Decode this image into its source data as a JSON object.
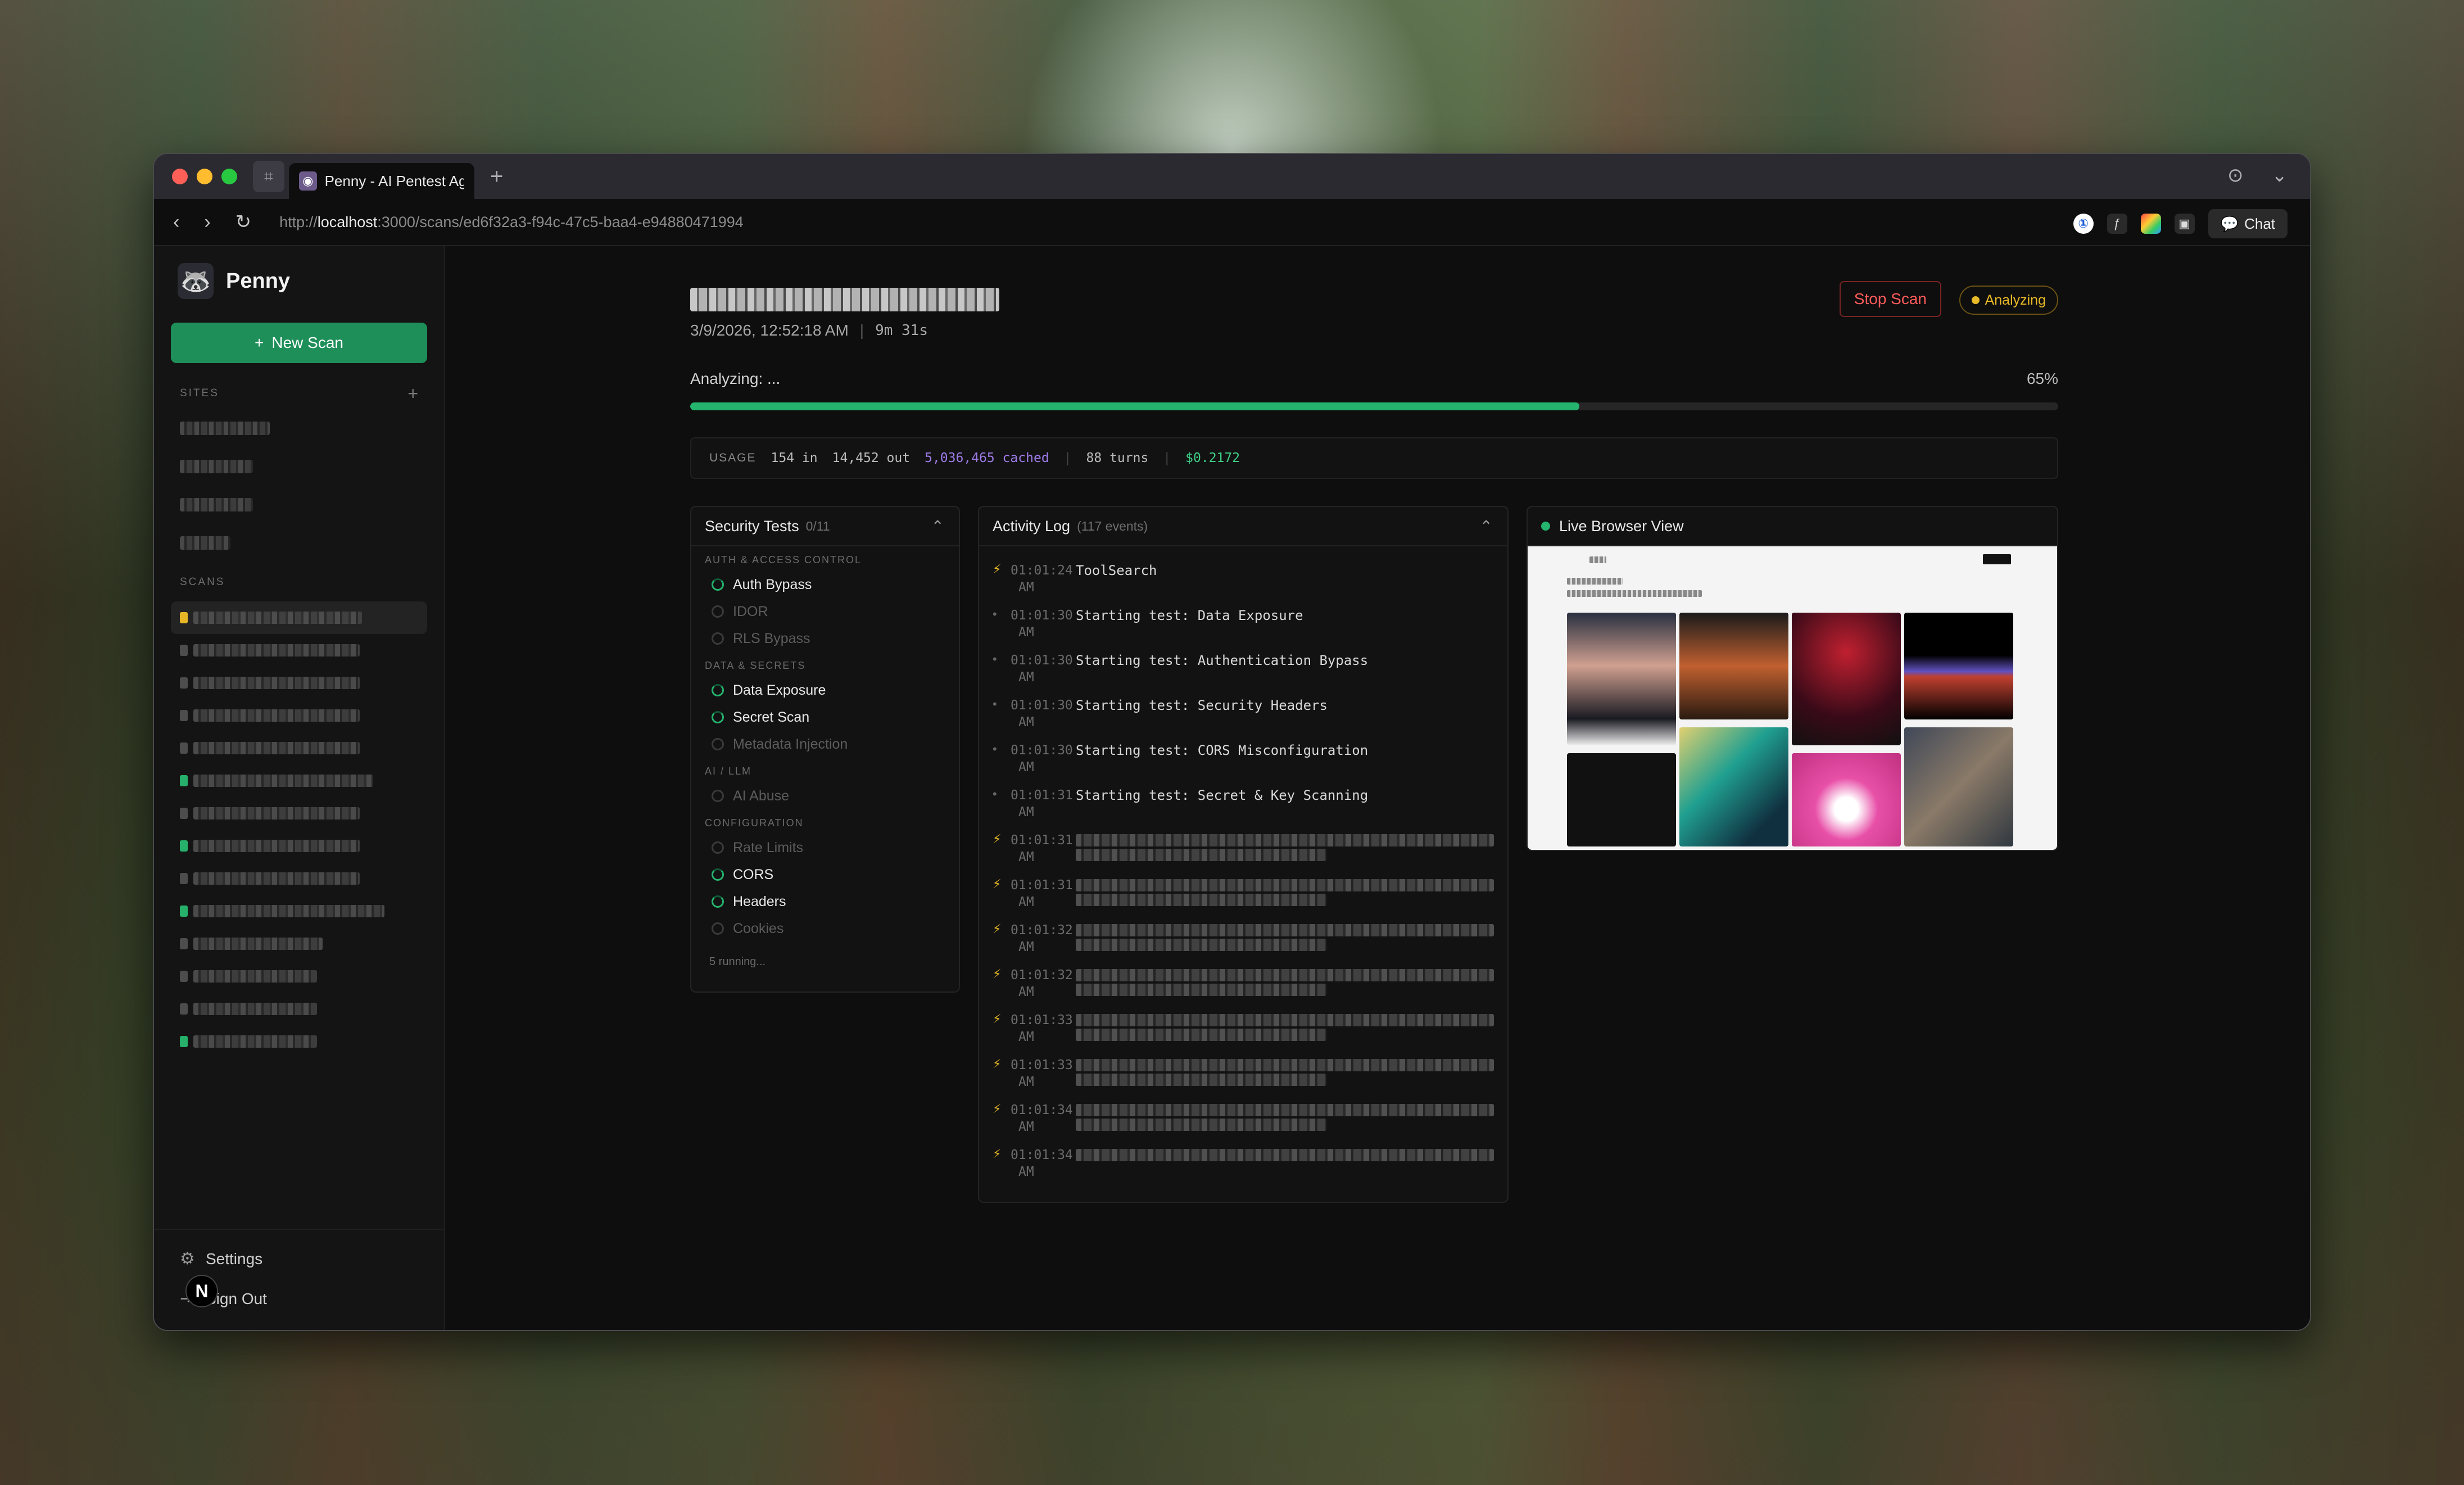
{
  "browser": {
    "tab_title": "Penny - AI Pentest Age",
    "url_prefix": "http://",
    "url_host": "localhost",
    "url_rest": ":3000/scans/ed6f32a3-f94c-47c5-baa4-e94880471994",
    "chat_label": "Chat"
  },
  "sidebar": {
    "brand": "Penny",
    "new_scan_label": "New Scan",
    "sites_label": "SITES",
    "scans_label": "SCANS",
    "settings_label": "Settings",
    "signout_label": "Sign Out",
    "badge_letter": "N"
  },
  "scan": {
    "timestamp": "3/9/2026, 12:52:18 AM",
    "duration": "9m 31s",
    "stop_label": "Stop Scan",
    "status": "Analyzing",
    "progress_label": "Analyzing: ...",
    "progress_pct_text": "65%",
    "progress": 0.65
  },
  "usage": {
    "label": "USAGE",
    "input": "154 in",
    "output": "14,452 out",
    "cached": "5,036,465 cached",
    "turns": "88 turns",
    "cost": "$0.2172"
  },
  "tests": {
    "title": "Security Tests",
    "count": "0/11",
    "categories": [
      {
        "name": "AUTH & ACCESS CONTROL",
        "items": [
          {
            "label": "Auth Bypass",
            "active": true
          },
          {
            "label": "IDOR",
            "active": false
          },
          {
            "label": "RLS Bypass",
            "active": false
          }
        ]
      },
      {
        "name": "DATA & SECRETS",
        "items": [
          {
            "label": "Data Exposure",
            "active": true
          },
          {
            "label": "Secret Scan",
            "active": true
          },
          {
            "label": "Metadata Injection",
            "active": false
          }
        ]
      },
      {
        "name": "AI / LLM",
        "items": [
          {
            "label": "AI Abuse",
            "active": false
          }
        ]
      },
      {
        "name": "CONFIGURATION",
        "items": [
          {
            "label": "Rate Limits",
            "active": false
          },
          {
            "label": "CORS",
            "active": true
          },
          {
            "label": "Headers",
            "active": true
          },
          {
            "label": "Cookies",
            "active": false
          }
        ]
      }
    ],
    "running_text": "5 running..."
  },
  "activity": {
    "title": "Activity Log",
    "count": "(117 events)",
    "events": [
      {
        "time": "01:01:24",
        "ampm": "AM",
        "msg": "ToolSearch",
        "icon": "bolt"
      },
      {
        "time": "01:01:30",
        "ampm": "AM",
        "msg": "Starting test: Data Exposure",
        "icon": "dot"
      },
      {
        "time": "01:01:30",
        "ampm": "AM",
        "msg": "Starting test: Authentication Bypass",
        "icon": "dot"
      },
      {
        "time": "01:01:30",
        "ampm": "AM",
        "msg": "Starting test: Security Headers",
        "icon": "dot"
      },
      {
        "time": "01:01:30",
        "ampm": "AM",
        "msg": "Starting test: CORS Misconfiguration",
        "icon": "dot"
      },
      {
        "time": "01:01:31",
        "ampm": "AM",
        "msg": "Starting test: Secret & Key Scanning",
        "icon": "dot"
      },
      {
        "time": "01:01:31",
        "ampm": "AM",
        "msg": "",
        "icon": "bolt"
      },
      {
        "time": "01:01:31",
        "ampm": "AM",
        "msg": "",
        "icon": "bolt"
      },
      {
        "time": "01:01:32",
        "ampm": "AM",
        "msg": "",
        "icon": "bolt"
      },
      {
        "time": "01:01:32",
        "ampm": "AM",
        "msg": "",
        "icon": "bolt"
      },
      {
        "time": "01:01:33",
        "ampm": "AM",
        "msg": "",
        "icon": "bolt"
      },
      {
        "time": "01:01:33",
        "ampm": "AM",
        "msg": "",
        "icon": "bolt"
      },
      {
        "time": "01:01:34",
        "ampm": "AM",
        "msg": "",
        "icon": "bolt"
      },
      {
        "time": "01:01:34",
        "ampm": "AM",
        "msg": "",
        "icon": "bolt"
      }
    ]
  },
  "live_view": {
    "title": "Live Browser View"
  },
  "colors": {
    "accent_green": "#25b46e",
    "warning_yellow": "#e8b928",
    "danger_red": "#ff5a5a",
    "cached_purple": "#9d7be6"
  }
}
